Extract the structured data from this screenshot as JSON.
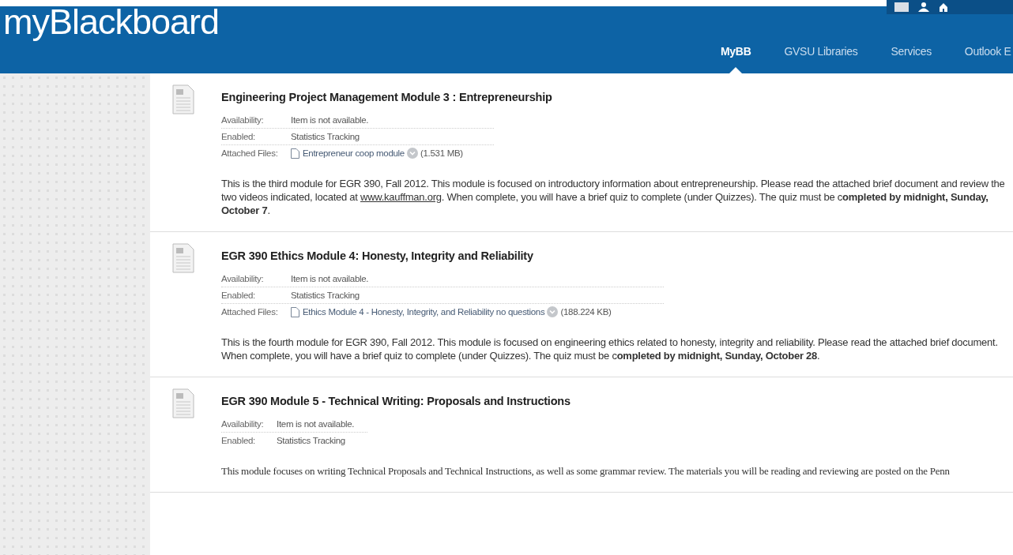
{
  "header": {
    "logo": "myBlackboard",
    "nav": [
      {
        "label": "MyBB",
        "selected": true
      },
      {
        "label": "GVSU Libraries",
        "selected": false
      },
      {
        "label": "Services",
        "selected": false
      },
      {
        "label": "Outlook E",
        "selected": false
      }
    ]
  },
  "items": [
    {
      "title": "Engineering Project Management Module 3 : Entrepreneurship",
      "details": [
        {
          "kind": "text",
          "label": "Availability:",
          "value": "Item is not available."
        },
        {
          "kind": "text",
          "label": "Enabled:",
          "value": "Statistics Tracking"
        },
        {
          "kind": "file",
          "label": "Attached Files:",
          "file": "Entrepreneur coop module",
          "size": "(1.531 MB)"
        }
      ],
      "description": [
        {
          "kind": "text",
          "text": "This is the third module for EGR 390, Fall 2012. This module is focused on introductory information about entrepreneurship. Please read the attached brief document and review the two videos indicated, located at "
        },
        {
          "kind": "link",
          "text": "www.kauffman.org"
        },
        {
          "kind": "text",
          "text": ". When complete, you will have a brief quiz to complete (under Quizzes). The quiz must be c**ompleted by midnight, Sunday, October 7**."
        }
      ]
    },
    {
      "title": "EGR 390 Ethics Module 4: Honesty, Integrity and Reliability",
      "details": [
        {
          "kind": "text",
          "label": "Availability:",
          "value": "Item is not available."
        },
        {
          "kind": "text",
          "label": "Enabled:",
          "value": "Statistics Tracking"
        },
        {
          "kind": "file",
          "label": "Attached Files:",
          "file": "Ethics Module 4 - Honesty, Integrity, and Reliability no questions",
          "size": "(188.224 KB)"
        }
      ],
      "description": [
        {
          "kind": "text",
          "text": "This is the fourth module for EGR 390, Fall 2012. This module is focused on engineering ethics related to honesty, integrity and reliability. Please read the attached brief document. When complete, you will have a brief quiz to complete (under Quizzes). The quiz must be c**ompleted by midnight, Sunday, October 28**."
        }
      ]
    },
    {
      "title": "EGR 390 Module 5 - Technical Writing: Proposals and Instructions",
      "details": [
        {
          "kind": "text",
          "label": "Availability:",
          "value": "Item is not available."
        },
        {
          "kind": "text",
          "label": "Enabled:",
          "value": "Statistics Tracking"
        }
      ],
      "description": [
        {
          "kind": "text",
          "text": "This module focuses on writing Technical Proposals and Technical Instructions, as well as some grammar review. The materials you will be reading and reviewing are posted on the Penn"
        }
      ]
    }
  ]
}
